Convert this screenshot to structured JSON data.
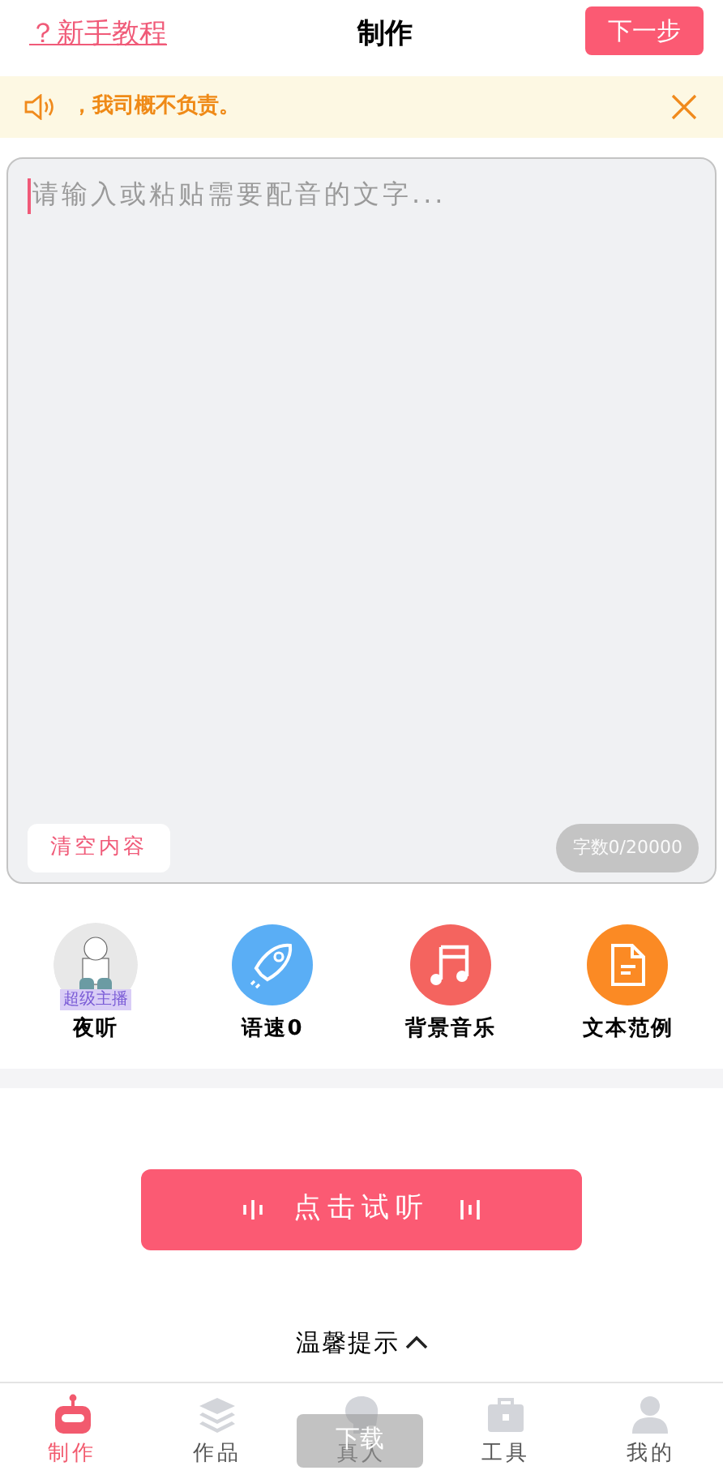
{
  "header": {
    "help_link": "？新手教程",
    "title": "制作",
    "next_button": "下一步"
  },
  "notice": {
    "text": "，我司概不负责。"
  },
  "editor": {
    "placeholder": "请输入或粘贴需要配音的文字...",
    "clear_button": "清空内容",
    "counter": "字数0/20000"
  },
  "tools": [
    {
      "label": "夜听",
      "badge": "超级主播"
    },
    {
      "kind": "speed",
      "label": "语速0"
    },
    {
      "kind": "music",
      "label": "背景音乐"
    },
    {
      "kind": "document",
      "label": "文本范例"
    }
  ],
  "preview_button": "点击试听",
  "tips_toggle": {
    "label": "温馨提示",
    "expanded": false
  },
  "tab_bar": [
    {
      "kind": "robot",
      "label": "制作",
      "selected": true
    },
    {
      "kind": "layers",
      "label": "作品",
      "selected": false
    },
    {
      "kind": "head",
      "label": "真人",
      "selected": false
    },
    {
      "kind": "toolbox",
      "label": "工具",
      "selected": false
    },
    {
      "kind": "person",
      "label": "我的",
      "selected": false
    }
  ],
  "toast": "下载"
}
